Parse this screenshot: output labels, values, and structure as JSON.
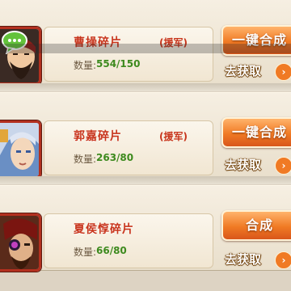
{
  "items": [
    {
      "name": "曹操碎片",
      "tag": "(援军)",
      "qty_label": "数量:",
      "qty": "554/150",
      "merge_label": "一键合成",
      "get_label": "去获取"
    },
    {
      "name": "郭嘉碎片",
      "tag": "(援军)",
      "qty_label": "数量:",
      "qty": "263/80",
      "merge_label": "一键合成",
      "get_label": "去获取"
    },
    {
      "name": "夏侯惇碎片",
      "tag": "",
      "qty_label": "数量:",
      "qty": "66/80",
      "merge_label": "合成",
      "get_label": "去获取"
    }
  ],
  "chevron_symbol": "›",
  "icons": [
    "chat-icon",
    "chevron-right-icon"
  ]
}
